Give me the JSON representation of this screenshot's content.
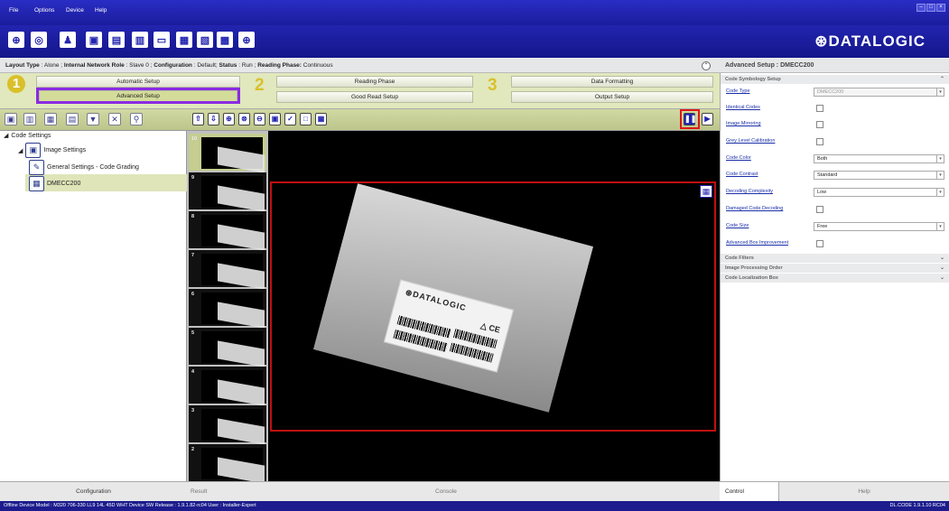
{
  "menu": [
    "File",
    "Options",
    "Device",
    "Help"
  ],
  "toolbar_icons": [
    "device-icon",
    "camera-icon",
    "user-icon",
    "monitor-icon",
    "image-icon",
    "image-settings-icon",
    "capture-icon",
    "layout-icon",
    "network-icon",
    "barcode-icon",
    "crosshair-icon"
  ],
  "brand": "⊛DATALOGIC",
  "status_line": {
    "layout_type_label": "Layout Type",
    "layout_type_value": "Alone",
    "network_role_label": "Internal Network Role",
    "network_role_value": "Slave 0",
    "configuration_label": "Configuration",
    "configuration_value": "Default",
    "status_label": "Status",
    "status_value": "Run",
    "reading_phase_label": "Reading Phase:",
    "reading_phase_value": "Continuous"
  },
  "phases": {
    "n1": "1",
    "n2": "2",
    "n3": "3",
    "automatic_setup": "Automatic Setup",
    "advanced_setup": "Advanced Setup",
    "reading_phase": "Reading Phase",
    "good_read_setup": "Good Read Setup",
    "data_formatting": "Data Formatting",
    "output_setup": "Output Setup"
  },
  "tree": {
    "root": "Code Settings",
    "image_settings": "Image Settings",
    "general_settings": "General Settings - Code Grading",
    "dmecc": "DMECC200"
  },
  "thumbnails": [
    "10",
    "9",
    "8",
    "7",
    "6",
    "5",
    "4",
    "3",
    "2"
  ],
  "viewer_label": {
    "brand": "⊛DATALOGIC",
    "ce": "△ CE"
  },
  "left_tab": "Configuration",
  "bottom_tabs": {
    "result": "Result",
    "console": "Console"
  },
  "right_panel": {
    "title": "Advanced Setup : DMECC200",
    "sections": {
      "symbology": "Code Symbology Setup",
      "filters": "Code Filters",
      "processing": "Image Processing Order",
      "localization": "Code Localization Box"
    },
    "props": {
      "code_type": {
        "label": "Code Type",
        "value": "DMECC200"
      },
      "identical_codes": {
        "label": "Identical Codes"
      },
      "image_mirroring": {
        "label": "Image Mirroring"
      },
      "grey_level": {
        "label": "Grey Level Calibration"
      },
      "code_color": {
        "label": "Code Color",
        "value": "Both"
      },
      "code_contrast": {
        "label": "Code Contrast",
        "value": "Standard"
      },
      "decoding_complexity": {
        "label": "Decoding Complexity",
        "value": "Low"
      },
      "damaged_code": {
        "label": "Damaged Code Decoding"
      },
      "code_size": {
        "label": "Code Size",
        "value": "Free"
      },
      "advanced_box": {
        "label": "Advanced Box Improvement"
      }
    },
    "tabs": {
      "control": "Control",
      "help": "Help"
    }
  },
  "statusbar": {
    "text": "Offline Device Model : M320 706-330 LL9 14L 45D WHT   Device SW Release : 1.9.1.82-rc04   User : Installer-Expert",
    "version": "DL.CODE 1.9.1.10 RC04"
  },
  "colors": {
    "menubar": "#1a1c9c",
    "phase_bg": "#e1e8bd",
    "highlight_purple": "#8a2be2",
    "highlight_red": "#e01818"
  }
}
